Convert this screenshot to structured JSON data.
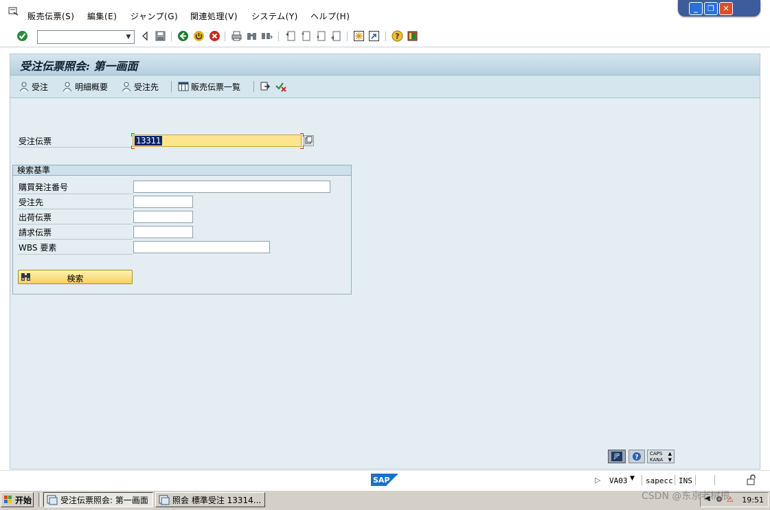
{
  "menubar": {
    "items": [
      "販売伝票(S)",
      "編集(E)",
      "ジャンプ(G)",
      "関連処理(V)",
      "システム(Y)",
      "ヘルプ(H)"
    ]
  },
  "toolbar": {
    "command_field": ""
  },
  "screen": {
    "title": "受注伝票照会: 第一画面"
  },
  "app_toolbar": {
    "buttons": [
      "受注",
      "明細概要",
      "受注先",
      "販売伝票一覧"
    ]
  },
  "order": {
    "label": "受注伝票",
    "value": "13311"
  },
  "search": {
    "group_title": "検索基準",
    "fields": [
      "購買発注番号",
      "受注先",
      "出荷伝票",
      "請求伝票",
      "WBS 要素"
    ],
    "button_label": "検索"
  },
  "status_indicators": {
    "lang": "JP",
    "caps": "CAPS",
    "kana": "KANA"
  },
  "statusbar": {
    "logo": "SAP",
    "tcode": "VA03",
    "server": "sapecc",
    "mode": "INS"
  },
  "taskbar": {
    "start_label": "开始",
    "tasks": [
      "受注伝票照会: 第一画面",
      "照会 標準受注 13314..."
    ],
    "clock": "19:51"
  },
  "watermark": "CSDN @东京老树根",
  "colors": {
    "main_bg": "#e4eef2",
    "titlebar_bg": "#c5dbe6",
    "input_highlight": "#fce58d",
    "selection": "#0b246a"
  }
}
